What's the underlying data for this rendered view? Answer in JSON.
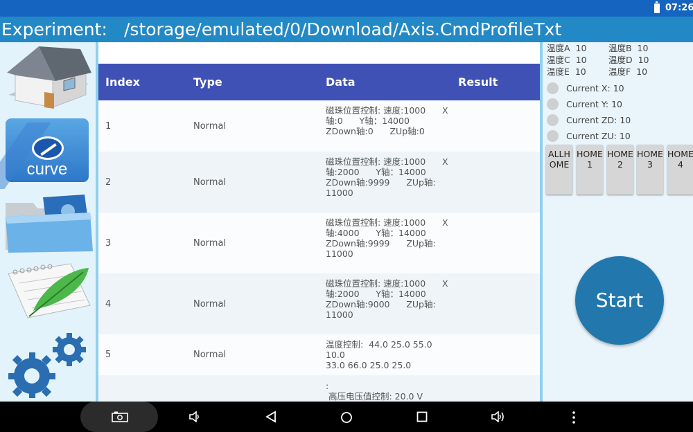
{
  "statusbar": {
    "time": "07:26"
  },
  "title": {
    "label": "Experiment:",
    "path": "/storage/emulated/0/Download/Axis.CmdProfileTxt"
  },
  "sidebar": {
    "icons": [
      "home-icon",
      "curve-icon",
      "folder-icon",
      "notepad-feather-icon",
      "settings-gears-icon"
    ],
    "curve_text": "curve"
  },
  "table": {
    "headers": {
      "index": "Index",
      "type": "Type",
      "data": "Data",
      "result": "Result"
    },
    "rows": [
      {
        "index": "1",
        "type": "Normal",
        "data": "磁珠位置控制: 速度:1000      X轴:0      Y轴：14000      ZDown轴:0      ZUp轴:0",
        "result": ""
      },
      {
        "index": "2",
        "type": "Normal",
        "data": "磁珠位置控制: 速度:1000      X轴:2000      Y轴：14000\nZDown轴:9999      ZUp轴:\n11000",
        "result": ""
      },
      {
        "index": "3",
        "type": "Normal",
        "data": "磁珠位置控制: 速度:1000      X轴:4000      Y轴：14000\nZDown轴:9999      ZUp轴:\n11000",
        "result": ""
      },
      {
        "index": "4",
        "type": "Normal",
        "data": "磁珠位置控制: 速度:1000      X轴:2000      Y轴：14000\nZDown轴:9000      ZUp轴:\n11000",
        "result": ""
      },
      {
        "index": "5",
        "type": "Normal",
        "data": "温度控制:  44.0 25.0 55.0 10.0\n33.0 66.0 25.0 25.0",
        "result": ""
      },
      {
        "index": "",
        "type": "",
        "data": ":\n 高压电压值控制: 20.0 V",
        "result": ""
      }
    ]
  },
  "temperatures": [
    {
      "label": "温度A",
      "value": "10"
    },
    {
      "label": "温度B",
      "value": "10"
    },
    {
      "label": "温度C",
      "value": "10"
    },
    {
      "label": "温度D",
      "value": "10"
    },
    {
      "label": "温度E",
      "value": "10"
    },
    {
      "label": "温度F",
      "value": "10"
    }
  ],
  "axes": [
    {
      "label": "Current X:",
      "value": "10"
    },
    {
      "label": "Current Y:",
      "value": "10"
    },
    {
      "label": "Current ZD:",
      "value": "10"
    },
    {
      "label": "Current ZU:",
      "value": "10"
    }
  ],
  "home_buttons": [
    "ALLHOME",
    "HOME1",
    "HOME2",
    "HOME3",
    "HOME4"
  ],
  "start_label": "Start",
  "colors": {
    "statusbar": "#1565c0",
    "titlebar": "#2389c6",
    "table_header": "#3f51b5",
    "start_button": "#2278ad"
  }
}
